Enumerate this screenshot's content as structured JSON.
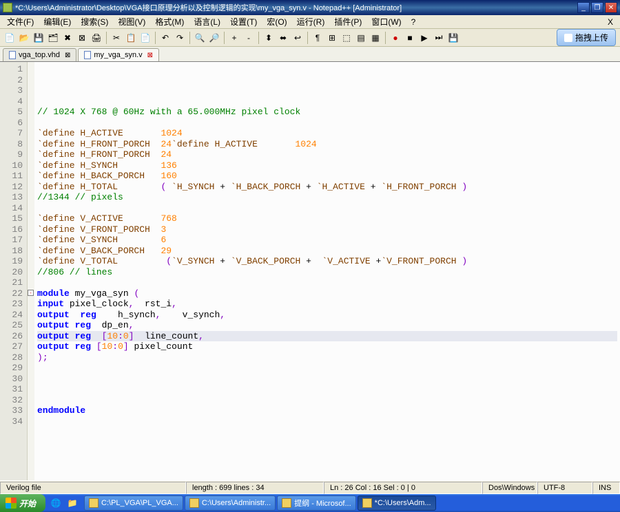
{
  "window": {
    "title": "*C:\\Users\\Administrator\\Desktop\\VGA接口原理分析以及控制逻辑的实现\\my_vga_syn.v - Notepad++ [Administrator]"
  },
  "menu": {
    "file": "文件(F)",
    "edit": "编辑(E)",
    "search": "搜索(S)",
    "view": "视图(V)",
    "format": "格式(M)",
    "language": "语言(L)",
    "settings": "设置(T)",
    "macro": "宏(O)",
    "run": "运行(R)",
    "plugins": "插件(P)",
    "window": "窗口(W)",
    "help": "?",
    "close_x": "X"
  },
  "upload_btn": "拖拽上传",
  "tabs": [
    {
      "label": "vga_top.vhd",
      "active": false,
      "close": "⊠"
    },
    {
      "label": "my_vga_syn.v",
      "active": true,
      "close": "⊠"
    }
  ],
  "line_count_display": 34,
  "fold_line": 22,
  "hl_line": 26,
  "code_lines": [
    {
      "n": 1,
      "tokens": []
    },
    {
      "n": 2,
      "tokens": []
    },
    {
      "n": 3,
      "tokens": []
    },
    {
      "n": 4,
      "tokens": []
    },
    {
      "n": 5,
      "tokens": [
        {
          "t": "// 1024 X 768 @ 60Hz with a 65.000MHz pixel clock",
          "c": "c-comment"
        }
      ]
    },
    {
      "n": 6,
      "tokens": []
    },
    {
      "n": 7,
      "tokens": [
        {
          "t": "`define H_ACTIVE       ",
          "c": "c-define"
        },
        {
          "t": "1024",
          "c": "c-num"
        }
      ]
    },
    {
      "n": 8,
      "tokens": [
        {
          "t": "`define H_FRONT_PORCH  ",
          "c": "c-define"
        },
        {
          "t": "24",
          "c": "c-num"
        },
        {
          "t": "`define H_ACTIVE       ",
          "c": "c-define"
        },
        {
          "t": "1024",
          "c": "c-num"
        }
      ]
    },
    {
      "n": 9,
      "tokens": [
        {
          "t": "`define H_FRONT_PORCH  ",
          "c": "c-define"
        },
        {
          "t": "24",
          "c": "c-num"
        }
      ]
    },
    {
      "n": 10,
      "tokens": [
        {
          "t": "`define H_SYNCH        ",
          "c": "c-define"
        },
        {
          "t": "136",
          "c": "c-num"
        }
      ]
    },
    {
      "n": 11,
      "tokens": [
        {
          "t": "`define H_BACK_PORCH   ",
          "c": "c-define"
        },
        {
          "t": "160",
          "c": "c-num"
        }
      ]
    },
    {
      "n": 12,
      "tokens": [
        {
          "t": "`define H_TOTAL        ",
          "c": "c-define"
        },
        {
          "t": "( ",
          "c": "c-punct"
        },
        {
          "t": "`H_SYNCH ",
          "c": "c-define"
        },
        {
          "t": "+ ",
          "c": ""
        },
        {
          "t": "`H_BACK_PORCH ",
          "c": "c-define"
        },
        {
          "t": "+ ",
          "c": ""
        },
        {
          "t": "`H_ACTIVE ",
          "c": "c-define"
        },
        {
          "t": "+ ",
          "c": ""
        },
        {
          "t": "`H_FRONT_PORCH ",
          "c": "c-define"
        },
        {
          "t": ")",
          "c": "c-punct"
        }
      ]
    },
    {
      "n": 13,
      "tokens": [
        {
          "t": "//1344 // pixels",
          "c": "c-comment"
        }
      ]
    },
    {
      "n": 14,
      "tokens": []
    },
    {
      "n": 15,
      "tokens": [
        {
          "t": "`define V_ACTIVE       ",
          "c": "c-define"
        },
        {
          "t": "768",
          "c": "c-num"
        }
      ]
    },
    {
      "n": 16,
      "tokens": [
        {
          "t": "`define V_FRONT_PORCH  ",
          "c": "c-define"
        },
        {
          "t": "3",
          "c": "c-num"
        }
      ]
    },
    {
      "n": 17,
      "tokens": [
        {
          "t": "`define V_SYNCH        ",
          "c": "c-define"
        },
        {
          "t": "6",
          "c": "c-num"
        }
      ]
    },
    {
      "n": 18,
      "tokens": [
        {
          "t": "`define V_BACK_PORCH   ",
          "c": "c-define"
        },
        {
          "t": "29",
          "c": "c-num"
        }
      ]
    },
    {
      "n": 19,
      "tokens": [
        {
          "t": "`define V_TOTAL         ",
          "c": "c-define"
        },
        {
          "t": "(",
          "c": "c-punct"
        },
        {
          "t": "`V_SYNCH ",
          "c": "c-define"
        },
        {
          "t": "+ ",
          "c": ""
        },
        {
          "t": "`V_BACK_PORCH ",
          "c": "c-define"
        },
        {
          "t": "+  ",
          "c": ""
        },
        {
          "t": "`V_ACTIVE ",
          "c": "c-define"
        },
        {
          "t": "+",
          "c": ""
        },
        {
          "t": "`V_FRONT_PORCH ",
          "c": "c-define"
        },
        {
          "t": ")",
          "c": "c-punct"
        }
      ]
    },
    {
      "n": 20,
      "tokens": [
        {
          "t": "//806 // lines",
          "c": "c-comment"
        }
      ]
    },
    {
      "n": 21,
      "tokens": []
    },
    {
      "n": 22,
      "tokens": [
        {
          "t": "module",
          "c": "c-keyword"
        },
        {
          "t": " my_vga_syn ",
          "c": ""
        },
        {
          "t": "(",
          "c": "c-punct"
        }
      ]
    },
    {
      "n": 23,
      "tokens": [
        {
          "t": "input",
          "c": "c-keyword"
        },
        {
          "t": " pixel_clock",
          "c": ""
        },
        {
          "t": ",",
          "c": "c-punct"
        },
        {
          "t": "  rst_i",
          "c": ""
        },
        {
          "t": ",",
          "c": "c-punct"
        }
      ]
    },
    {
      "n": 24,
      "tokens": [
        {
          "t": "output",
          "c": "c-keyword"
        },
        {
          "t": "  ",
          "c": ""
        },
        {
          "t": "reg",
          "c": "c-keyword"
        },
        {
          "t": "    h_synch",
          "c": ""
        },
        {
          "t": ",",
          "c": "c-punct"
        },
        {
          "t": "    v_synch",
          "c": ""
        },
        {
          "t": ",",
          "c": "c-punct"
        }
      ]
    },
    {
      "n": 25,
      "tokens": [
        {
          "t": "output",
          "c": "c-keyword"
        },
        {
          "t": " ",
          "c": ""
        },
        {
          "t": "reg",
          "c": "c-keyword"
        },
        {
          "t": "  dp_en",
          "c": ""
        },
        {
          "t": ",",
          "c": "c-punct"
        }
      ]
    },
    {
      "n": 26,
      "tokens": [
        {
          "t": "output",
          "c": "c-keyword"
        },
        {
          "t": " ",
          "c": ""
        },
        {
          "t": "reg",
          "c": "c-keyword"
        },
        {
          "t": "  ",
          "c": ""
        },
        {
          "t": "[",
          "c": "c-punct"
        },
        {
          "t": "10",
          "c": "c-num"
        },
        {
          "t": ":",
          "c": "c-punct"
        },
        {
          "t": "0",
          "c": "c-num"
        },
        {
          "t": "]",
          "c": "c-punct"
        },
        {
          "t": "  line_count",
          "c": ""
        },
        {
          "t": ",",
          "c": "c-punct"
        }
      ]
    },
    {
      "n": 27,
      "tokens": [
        {
          "t": "output",
          "c": "c-keyword"
        },
        {
          "t": " ",
          "c": ""
        },
        {
          "t": "reg",
          "c": "c-keyword"
        },
        {
          "t": " ",
          "c": ""
        },
        {
          "t": "[",
          "c": "c-punct"
        },
        {
          "t": "10",
          "c": "c-num"
        },
        {
          "t": ":",
          "c": "c-punct"
        },
        {
          "t": "0",
          "c": "c-num"
        },
        {
          "t": "]",
          "c": "c-punct"
        },
        {
          "t": " pixel_count",
          "c": ""
        }
      ]
    },
    {
      "n": 28,
      "tokens": [
        {
          "t": ")",
          "c": "c-punct"
        },
        {
          "t": ";",
          "c": "c-punct"
        }
      ]
    },
    {
      "n": 29,
      "tokens": []
    },
    {
      "n": 30,
      "tokens": []
    },
    {
      "n": 31,
      "tokens": []
    },
    {
      "n": 32,
      "tokens": []
    },
    {
      "n": 33,
      "tokens": [
        {
          "t": "endmodule",
          "c": "c-keyword"
        }
      ]
    },
    {
      "n": 34,
      "tokens": []
    }
  ],
  "status": {
    "filetype": "Verilog file",
    "length": "length : 699    lines : 34",
    "pos": "Ln : 26    Col : 16    Sel : 0 | 0",
    "eol": "Dos\\Windows",
    "enc": "UTF-8",
    "ins": "INS"
  },
  "taskbar": {
    "start": "开始",
    "tasks": [
      {
        "label": "C:\\PL_VGA\\PL_VGA..."
      },
      {
        "label": "C:\\Users\\Administr..."
      },
      {
        "label": "提纲 - Microsof..."
      },
      {
        "label": "*C:\\Users\\Adm...",
        "active": true
      }
    ]
  }
}
